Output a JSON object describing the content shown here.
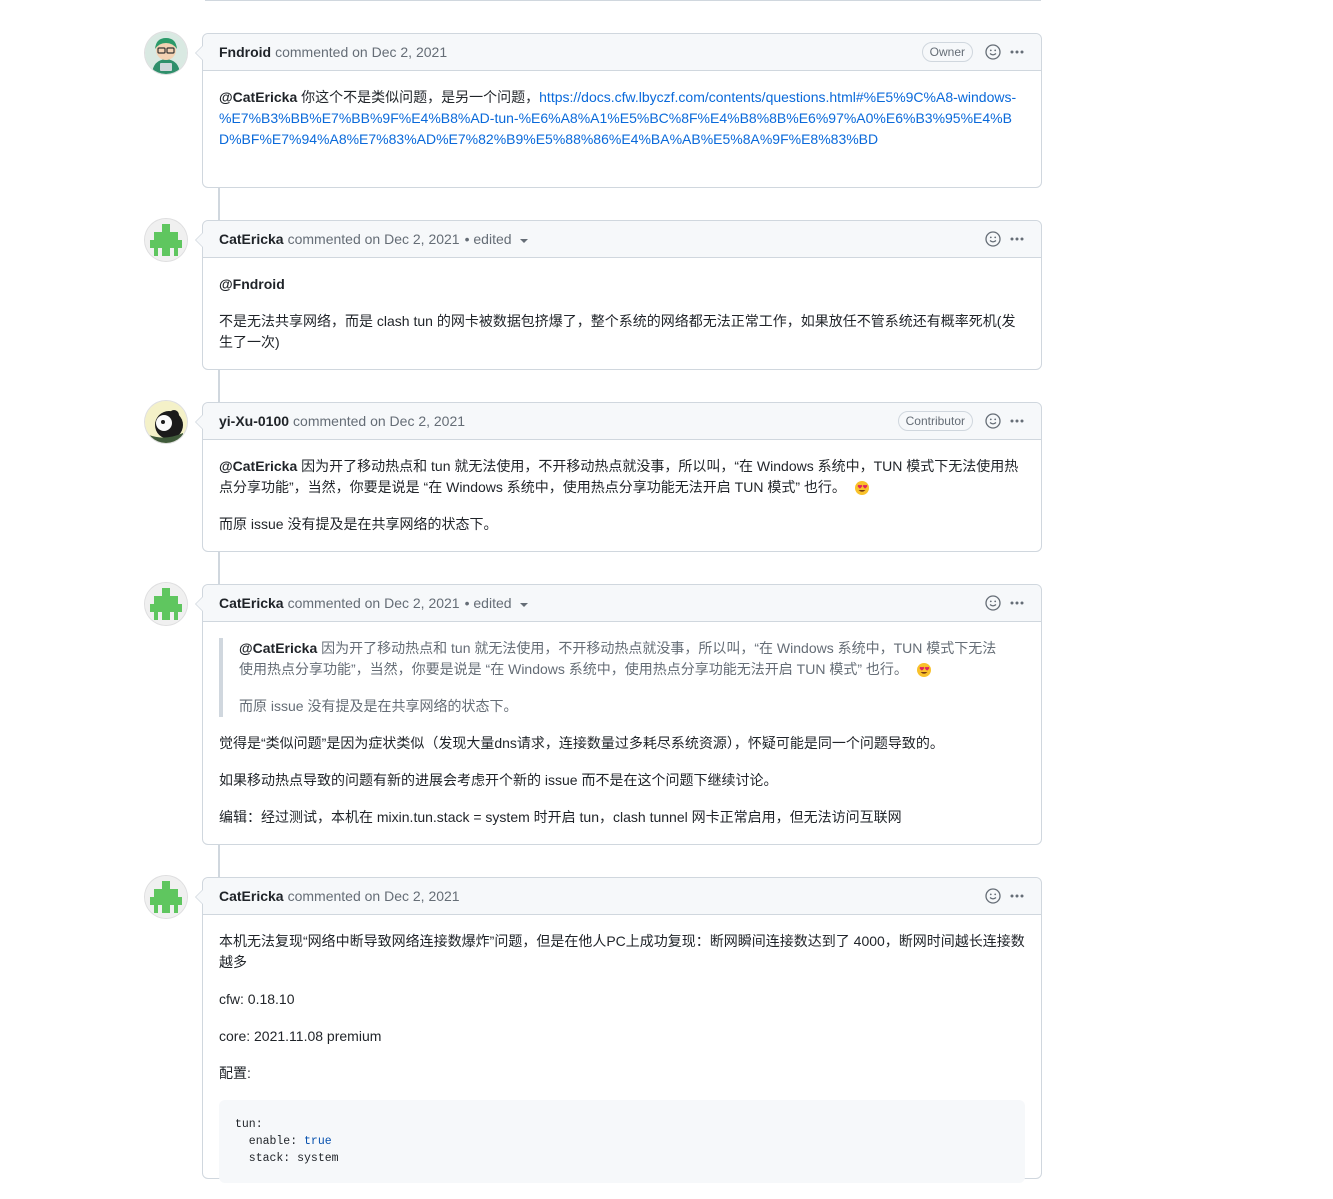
{
  "comments": [
    {
      "author": "Fndroid",
      "meta": "commented on Dec 2, 2021",
      "badge": "Owner",
      "body": {
        "mention": "@CatEricka",
        "text": " 你这个不是类似问题，是另一个问题，",
        "link": "https://docs.cfw.lbyczf.com/contents/questions.html#%E5%9C%A8-windows-%E7%B3%BB%E7%BB%9F%E4%B8%AD-tun-%E6%A8%A1%E5%BC%8F%E4%B8%8B%E6%97%A0%E6%B3%95%E4%BD%BF%E7%94%A8%E7%83%AD%E7%82%B9%E5%88%86%E4%BA%AB%E5%8A%9F%E8%83%BD"
      }
    },
    {
      "author": "CatEricka",
      "meta": "commented on Dec 2, 2021",
      "edited": "• edited",
      "body": {
        "p1": "@Fndroid",
        "p2": "不是无法共享网络，而是 clash tun 的网卡被数据包挤爆了，整个系统的网络都无法正常工作，如果放任不管系统还有概率死机(发生了一次)"
      }
    },
    {
      "author": "yi-Xu-0100",
      "meta": "commented on Dec 2, 2021",
      "badge": "Contributor",
      "body": {
        "mention": "@CatEricka",
        "p1": " 因为开了移动热点和 tun 就无法使用，不开移动热点就没事，所以叫，“在 Windows 系统中，TUN 模式下无法使用热点分享功能”，当然，你要是说是 “在 Windows 系统中，使用热点分享功能无法开启 TUN 模式” 也行。",
        "p2": "而原 issue 没有提及是在共享网络的状态下。"
      }
    },
    {
      "author": "CatEricka",
      "meta": "commented on Dec 2, 2021",
      "edited": "• edited",
      "body": {
        "quote_mention": "@CatEricka",
        "quote_p1": " 因为开了移动热点和 tun 就无法使用，不开移动热点就没事，所以叫，“在 Windows 系统中，TUN 模式下无法使用热点分享功能”，当然，你要是说是 “在 Windows 系统中，使用热点分享功能无法开启 TUN 模式” 也行。",
        "quote_p2": "而原 issue 没有提及是在共享网络的状态下。",
        "p1": "觉得是“类似问题”是因为症状类似（发现大量dns请求，连接数量过多耗尽系统资源），怀疑可能是同一个问题导致的。",
        "p2": "如果移动热点导致的问题有新的进展会考虑开个新的 issue 而不是在这个问题下继续讨论。",
        "p3": "编辑：经过测试，本机在 mixin.tun.stack = system 时开启 tun，clash tunnel 网卡正常启用，但无法访问互联网"
      }
    },
    {
      "author": "CatEricka",
      "meta": "commented on Dec 2, 2021",
      "body": {
        "p1": "本机无法复现“网络中断导致网络连接数爆炸”问题，但是在他人PC上成功复现：断网瞬间连接数达到了 4000，断网时间越长连接数越多",
        "p2": "cfw: 0.18.10",
        "p3": "core: 2021.11.08 premium",
        "p4": "配置:",
        "code_l1": "tun:",
        "code_l2_key": "  enable: ",
        "code_l2_val": "true",
        "code_l3_key": "  stack: ",
        "code_l3_val": "system"
      }
    }
  ],
  "icons": {
    "smiley": "smiley-icon",
    "kebab": "kebab-horizontal-icon",
    "emoji": "smiling-face-with-hearts-emoji"
  },
  "colors": {
    "link": "#0969da",
    "border": "#d0d7de",
    "header_bg": "#f6f8fa",
    "identicon_green": "#5fc65f"
  }
}
